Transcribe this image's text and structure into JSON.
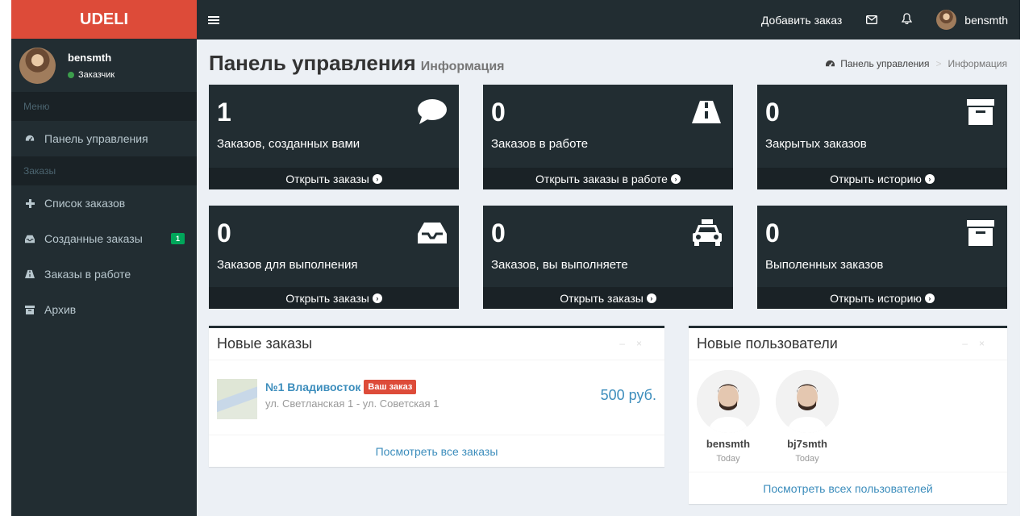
{
  "sidebar": {
    "logo": "UDELI",
    "user": {
      "name": "bensmth",
      "status": "Заказчик"
    },
    "sections": [
      {
        "header": "Меню",
        "items": [
          {
            "label": "Панель управления",
            "icon": "dashboard-icon"
          }
        ]
      },
      {
        "header": "Заказы",
        "items": [
          {
            "label": "Список заказов",
            "icon": "plus-icon"
          },
          {
            "label": "Созданные заказы",
            "icon": "inbox-icon",
            "badge": "1"
          },
          {
            "label": "Заказы в работе",
            "icon": "road-icon"
          },
          {
            "label": "Архив",
            "icon": "archive-icon"
          }
        ]
      }
    ]
  },
  "topbar": {
    "add_order": "Добавить заказ",
    "username": "bensmth"
  },
  "header": {
    "title": "Панель управления",
    "subtitle": "Информация",
    "breadcrumb": [
      "Панель управления",
      "Информация"
    ]
  },
  "stat_boxes": [
    {
      "value": "1",
      "label": "Заказов, созданных вами",
      "link": "Открыть заказы",
      "icon": "comment-icon"
    },
    {
      "value": "0",
      "label": "Заказов в работе",
      "link": "Открыть заказы в работе",
      "icon": "road-icon"
    },
    {
      "value": "0",
      "label": "Закрытых заказов",
      "link": "Открыть историю",
      "icon": "archive-icon"
    },
    {
      "value": "0",
      "label": "Заказов для выполнения",
      "link": "Открыть заказы",
      "icon": "inbox-icon"
    },
    {
      "value": "0",
      "label": "Заказов, вы выполняете",
      "link": "Открыть заказы",
      "icon": "taxi-icon"
    },
    {
      "value": "0",
      "label": "Выполенных заказов",
      "link": "Открыть историю",
      "icon": "archive-icon"
    }
  ],
  "new_orders": {
    "title": "Новые заказы",
    "items": [
      {
        "title": "№1 Владивосток",
        "badge": "Ваш заказ",
        "address": "ул. Светланская 1 - ул. Советская 1",
        "price": "500 руб."
      }
    ],
    "footer": "Посмотреть все заказы"
  },
  "new_users": {
    "title": "Новые пользователи",
    "users": [
      {
        "name": "bensmth",
        "date": "Today"
      },
      {
        "name": "bj7smth",
        "date": "Today"
      }
    ],
    "footer": "Посмотреть всех пользователей"
  },
  "colors": {
    "logo_bg": "#dd4b39",
    "dark": "#222d32",
    "accent": "#3c8dbc",
    "badge_green": "#00a65a"
  }
}
